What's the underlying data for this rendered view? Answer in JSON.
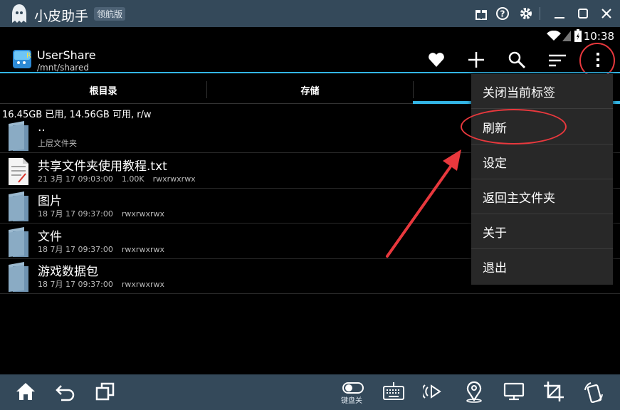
{
  "emulator": {
    "app_name": "小皮助手",
    "edition": "领航版",
    "keyboard_label": "键盘关",
    "accent": "#34495a"
  },
  "status_bar": {
    "time": "10:38"
  },
  "action_bar": {
    "title": "UserShare",
    "path": "/mnt/shared",
    "icons": [
      "favorite-icon",
      "add-icon",
      "search-icon",
      "sort-icon",
      "overflow-menu-icon"
    ]
  },
  "tabs": [
    {
      "label": "根目录"
    },
    {
      "label": "存储"
    },
    {
      "label": ""
    }
  ],
  "storage_info": "16.45GB 已用, 14.56GB 可用, r/w",
  "files": [
    {
      "name": "..",
      "meta": [
        "上层文件夹"
      ],
      "type": "folder"
    },
    {
      "name": "共享文件夹使用教程.txt",
      "meta": [
        "21 3月 17 09:03:00",
        "1.00K",
        "rwxrwxrwx"
      ],
      "type": "text"
    },
    {
      "name": "图片",
      "meta": [
        "18 7月 17 09:37:00",
        "rwxrwxrwx"
      ],
      "type": "folder"
    },
    {
      "name": "文件",
      "meta": [
        "18 7月 17 09:37:00",
        "rwxrwxrwx"
      ],
      "type": "folder"
    },
    {
      "name": "游戏数据包",
      "meta": [
        "18 7月 17 09:37:00",
        "rwxrwxrwx"
      ],
      "type": "folder"
    }
  ],
  "menu": {
    "items": [
      {
        "label": "关闭当前标签"
      },
      {
        "label": "刷新"
      },
      {
        "label": "设定"
      },
      {
        "label": "返回主文件夹"
      },
      {
        "label": "关于"
      },
      {
        "label": "退出"
      }
    ]
  },
  "colors": {
    "highlight": "#33b5e5",
    "annotation_red": "#e8383d"
  }
}
